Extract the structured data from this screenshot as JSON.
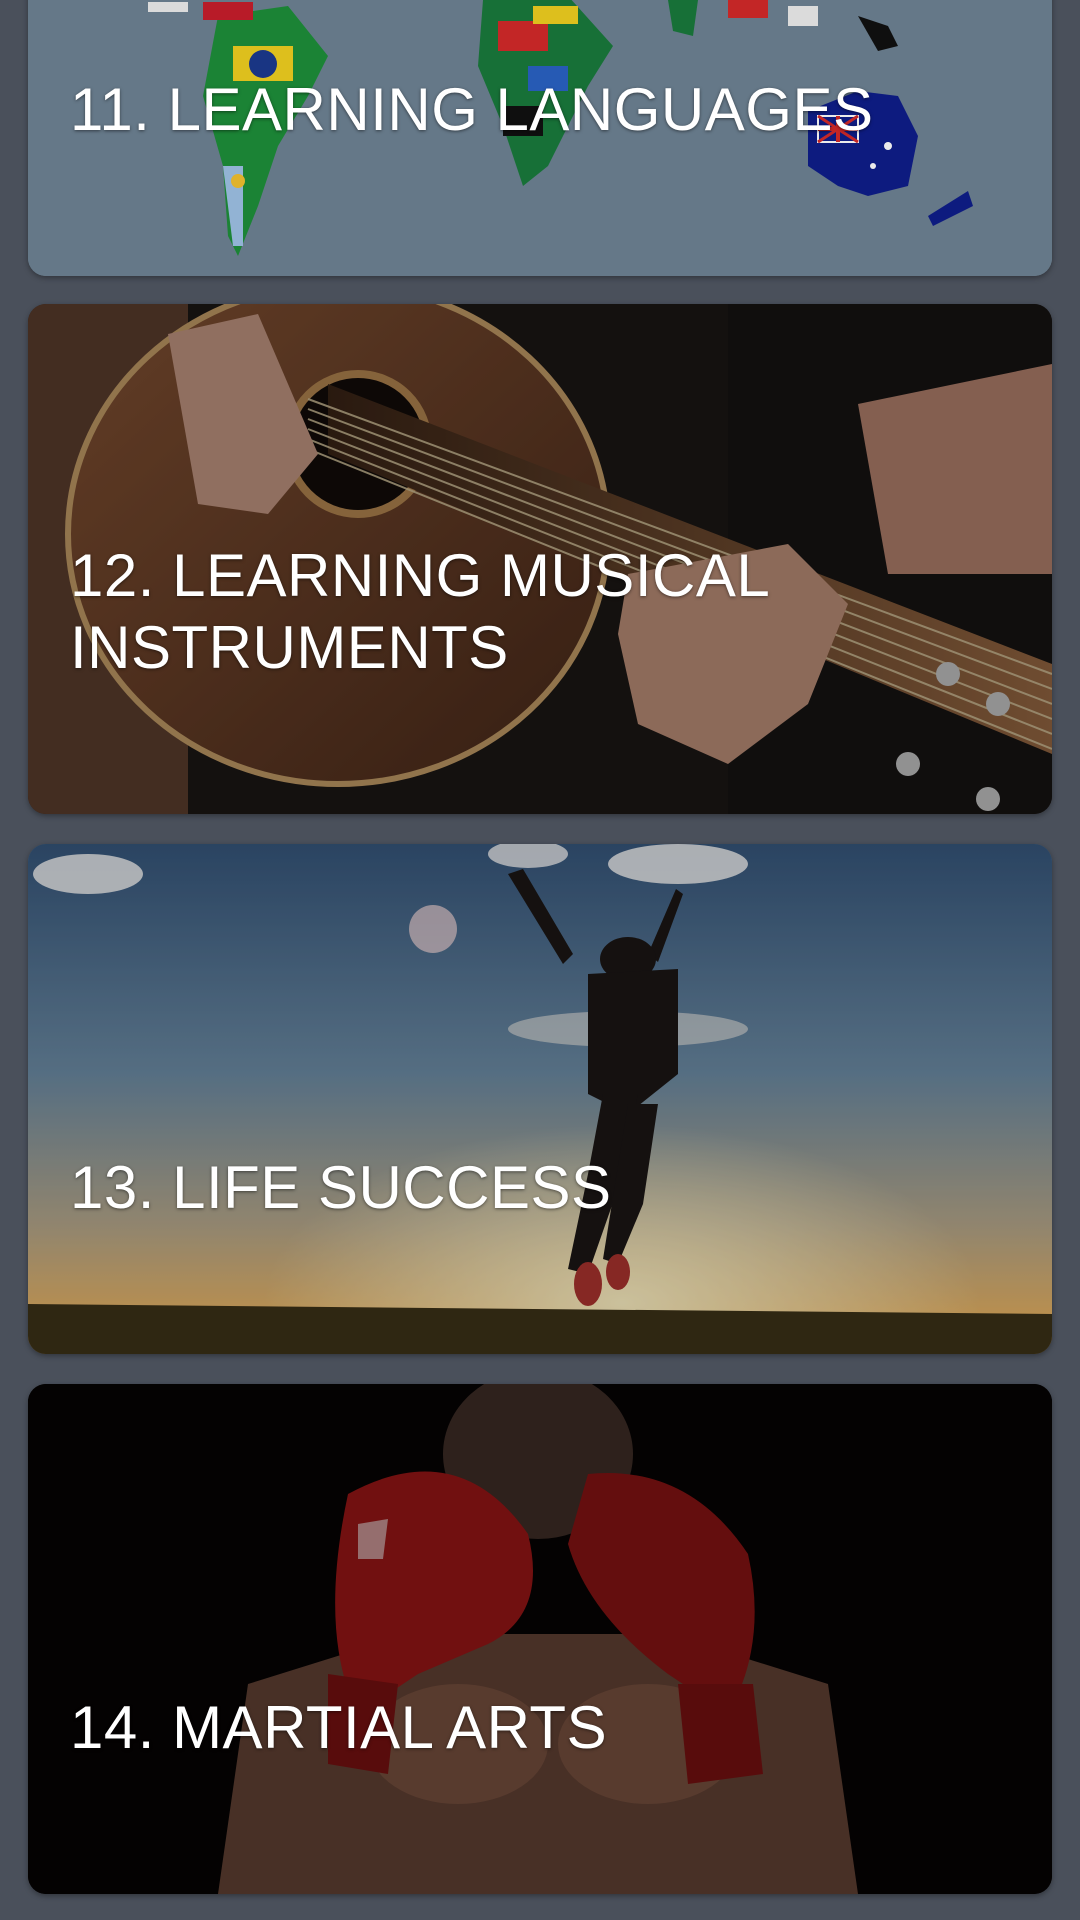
{
  "categories": [
    {
      "title": "11. LEARNING LANGUAGES"
    },
    {
      "title": "12. LEARNING MUSICAL INSTRUMENTS"
    },
    {
      "title": "13. LIFE SUCCESS"
    },
    {
      "title": "14. MARTIAL ARTS"
    }
  ],
  "colors": {
    "background": "#4a505b",
    "title_text": "#ffffff"
  }
}
